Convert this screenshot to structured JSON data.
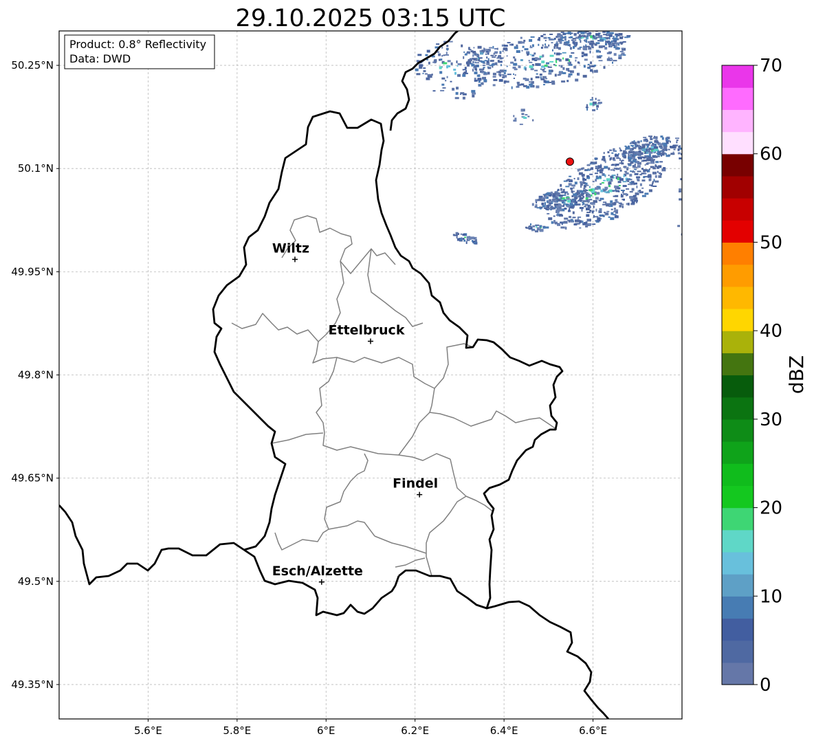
{
  "map": {
    "title": "29.10.2025 03:15 UTC",
    "info_lines": [
      "Product: 0.8° Reflectivity",
      "Data: DWD"
    ],
    "extent": {
      "lon": [
        5.4,
        6.8
      ],
      "lat": [
        49.3,
        50.3
      ]
    },
    "x_ticks": [
      {
        "value": 5.6,
        "label": "5.6°E"
      },
      {
        "value": 5.8,
        "label": "5.8°E"
      },
      {
        "value": 6.0,
        "label": "6°E"
      },
      {
        "value": 6.2,
        "label": "6.2°E"
      },
      {
        "value": 6.4,
        "label": "6.4°E"
      },
      {
        "value": 6.6,
        "label": "6.6°E"
      }
    ],
    "y_ticks": [
      {
        "value": 50.25,
        "label": "50.25°N"
      },
      {
        "value": 50.1,
        "label": "50.1°N"
      },
      {
        "value": 49.95,
        "label": "49.95°N"
      },
      {
        "value": 49.8,
        "label": "49.8°N"
      },
      {
        "value": 49.65,
        "label": "49.65°N"
      },
      {
        "value": 49.5,
        "label": "49.5°N"
      },
      {
        "value": 49.35,
        "label": "49.35°N"
      }
    ],
    "cities": [
      {
        "name": "Wiltz",
        "lon": 5.93,
        "lat": 49.968
      },
      {
        "name": "Ettelbruck",
        "lon": 6.1,
        "lat": 49.849
      },
      {
        "name": "Findel",
        "lon": 6.21,
        "lat": 49.626
      },
      {
        "name": "Esch/Alzette",
        "lon": 5.99,
        "lat": 49.499
      }
    ],
    "radar_site": {
      "lon": 6.548,
      "lat": 50.11,
      "color": "#ee1111"
    },
    "colorbar": {
      "label": "dBZ",
      "min": 0,
      "max": 70,
      "step": 2.5,
      "tick_values": [
        0,
        10,
        20,
        30,
        40,
        50,
        60,
        70
      ],
      "colors": [
        "#6577a8",
        "#4f69a2",
        "#425ea0",
        "#477cb3",
        "#5ea0c6",
        "#68c0dc",
        "#5fd7c7",
        "#3ed674",
        "#14c81f",
        "#10bc1c",
        "#0fa31a",
        "#0e8c17",
        "#0b7411",
        "#075c0c",
        "#447510",
        "#aab20a",
        "#ffd600",
        "#ffb800",
        "#ff9c00",
        "#ff7f00",
        "#e30000",
        "#c80000",
        "#a10000",
        "#780000",
        "#ffdfff",
        "#ffb4ff",
        "#ff6bff",
        "#ea36ea"
      ]
    }
  }
}
